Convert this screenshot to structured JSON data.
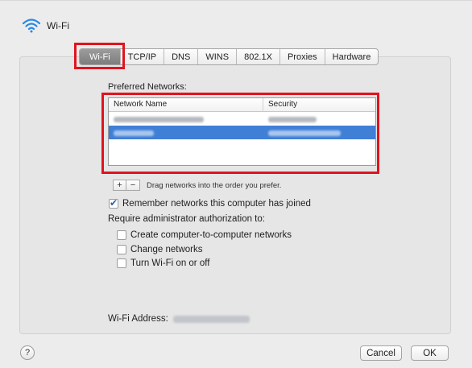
{
  "window": {
    "title": "Wi-Fi",
    "title_icon": "wifi-icon"
  },
  "tabs": [
    {
      "label": "Wi-Fi",
      "active": true
    },
    {
      "label": "TCP/IP",
      "active": false
    },
    {
      "label": "DNS",
      "active": false
    },
    {
      "label": "WINS",
      "active": false
    },
    {
      "label": "802.1X",
      "active": false
    },
    {
      "label": "Proxies",
      "active": false
    },
    {
      "label": "Hardware",
      "active": false
    }
  ],
  "preferred_networks": {
    "label": "Preferred Networks:",
    "columns": [
      "Network Name",
      "Security"
    ],
    "rows": [
      {
        "name": "",
        "security": "",
        "selected": false,
        "redacted": true
      },
      {
        "name": "",
        "security": "",
        "selected": true,
        "redacted": true
      }
    ]
  },
  "list_controls": {
    "add_label": "+",
    "remove_label": "−",
    "hint": "Drag networks into the order you prefer."
  },
  "options": {
    "remember": {
      "label": "Remember networks this computer has joined",
      "checked": true
    },
    "require_label": "Require administrator authorization to:",
    "items": [
      {
        "label": "Create computer-to-computer networks",
        "checked": false
      },
      {
        "label": "Change networks",
        "checked": false
      },
      {
        "label": "Turn Wi-Fi on or off",
        "checked": false
      }
    ]
  },
  "address": {
    "label": "Wi-Fi Address:",
    "value_redacted": true
  },
  "footer": {
    "help_label": "?",
    "cancel_label": "Cancel",
    "ok_label": "OK"
  },
  "colors": {
    "highlight": "#e0141e",
    "selection": "#3f7fd6",
    "active_tab": "#8a8a8a"
  }
}
